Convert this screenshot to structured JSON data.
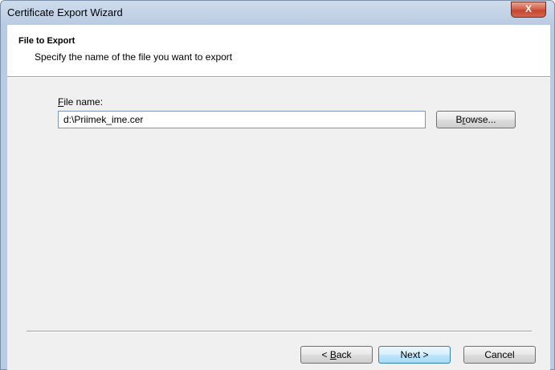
{
  "window": {
    "title": "Certificate Export Wizard",
    "close_symbol": "X"
  },
  "header": {
    "title": "File to Export",
    "subtitle": "Specify the name of the file you want to export"
  },
  "form": {
    "file_label_prefix": "",
    "file_label_accel": "F",
    "file_label_rest": "ile name:",
    "file_value": "d:\\Priimek_ime.cer",
    "browse_pre": "B",
    "browse_accel": "r",
    "browse_rest": "owse..."
  },
  "footer": {
    "back_pre": "< ",
    "back_accel": "B",
    "back_rest": "ack",
    "next_label": "Next >",
    "cancel_label": "Cancel"
  }
}
